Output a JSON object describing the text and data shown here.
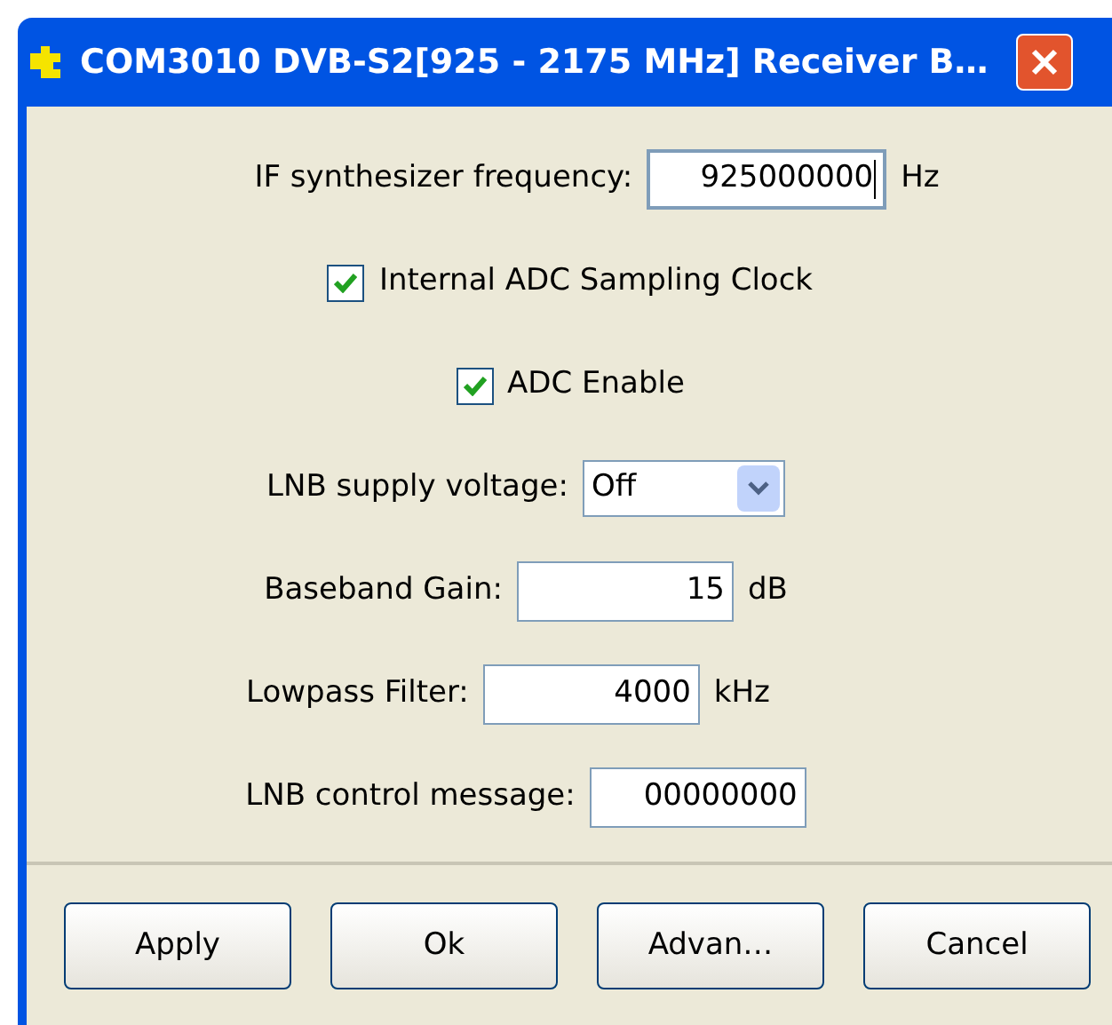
{
  "window": {
    "title": "COM3010 DVB-S2[925 - 2175 MHz] Receiver B…"
  },
  "rows": [
    {
      "kind": "text_field",
      "label": "IF synthesizer frequency:",
      "value": "925000000",
      "unit": "Hz",
      "focused": true
    },
    {
      "kind": "checkbox",
      "label": "Internal ADC Sampling Clock",
      "checked": true
    },
    {
      "kind": "checkbox",
      "label": "ADC Enable",
      "checked": true
    },
    {
      "kind": "dropdown",
      "label": "LNB supply voltage:",
      "value": "Off"
    },
    {
      "kind": "text_field",
      "label": "Baseband Gain:",
      "value": "15",
      "unit": "dB",
      "focused": false
    },
    {
      "kind": "text_field",
      "label": "Lowpass Filter:",
      "value": "4000",
      "unit": "kHz",
      "focused": false
    },
    {
      "kind": "text_field",
      "label": "LNB control message:",
      "value": "00000000",
      "focused": false
    }
  ],
  "buttons": [
    "Apply",
    "Ok",
    "Advan…",
    "Cancel"
  ]
}
